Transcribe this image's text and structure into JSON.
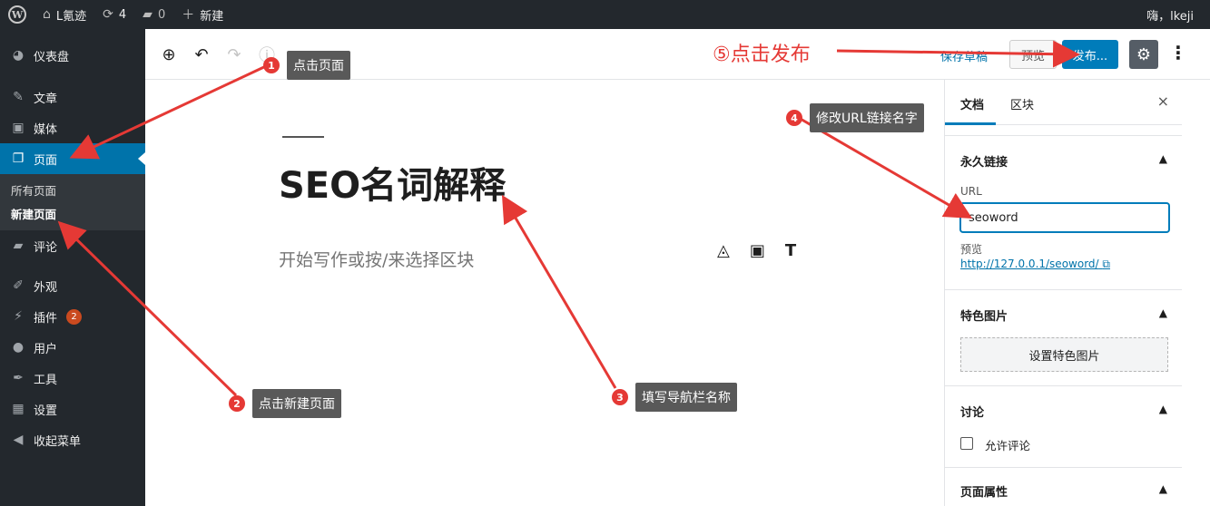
{
  "adminbar": {
    "site_name": "L氪迹",
    "updates_count": "4",
    "comments_count": "0",
    "new_label": "新建",
    "greeting": "嗨，lkeji"
  },
  "sidebar": {
    "items": [
      {
        "label": "仪表盘",
        "icon": "dashboard-icon"
      },
      {
        "label": "文章",
        "icon": "pin-icon"
      },
      {
        "label": "媒体",
        "icon": "media-icon"
      },
      {
        "label": "页面",
        "icon": "pages-icon"
      },
      {
        "label": "评论",
        "icon": "comment-icon"
      },
      {
        "label": "外观",
        "icon": "brush-icon"
      },
      {
        "label": "插件",
        "icon": "plugin-icon",
        "badge": "2"
      },
      {
        "label": "用户",
        "icon": "user-icon"
      },
      {
        "label": "工具",
        "icon": "wrench-icon"
      },
      {
        "label": "设置",
        "icon": "settings-icon"
      },
      {
        "label": "收起菜单",
        "icon": "collapse-icon"
      }
    ],
    "submenu": [
      "所有页面",
      "新建页面"
    ]
  },
  "toolbar": {
    "save_draft": "保存草稿",
    "preview": "预览",
    "publish": "发布...",
    "more": "⋮"
  },
  "editor": {
    "title": "SEO名词解释",
    "placeholder": "开始写作或按/来选择区块"
  },
  "panel": {
    "tabs": [
      "文档",
      "区块"
    ],
    "close": "×",
    "permalink": {
      "heading": "永久链接",
      "url_label": "URL",
      "url_value": "seoword",
      "preview_label": "预览",
      "preview_link": "http://127.0.0.1/seoword/"
    },
    "featured": {
      "heading": "特色图片",
      "button": "设置特色图片"
    },
    "discussion": {
      "heading": "讨论",
      "checkbox_label": "允许评论"
    },
    "attributes": {
      "heading": "页面属性"
    }
  },
  "annotations": {
    "step1": {
      "num": "1",
      "text": "点击页面"
    },
    "step2": {
      "num": "2",
      "text": "点击新建页面"
    },
    "step3": {
      "num": "3",
      "text": "填写导航栏名称"
    },
    "step4": {
      "num": "4",
      "text": "修改URL链接名字"
    },
    "step5": "⑤点击发布",
    "color": "#e53935"
  },
  "colors": {
    "adminbar": "#23282d",
    "accent": "#0073aa",
    "publish": "#007cba"
  }
}
